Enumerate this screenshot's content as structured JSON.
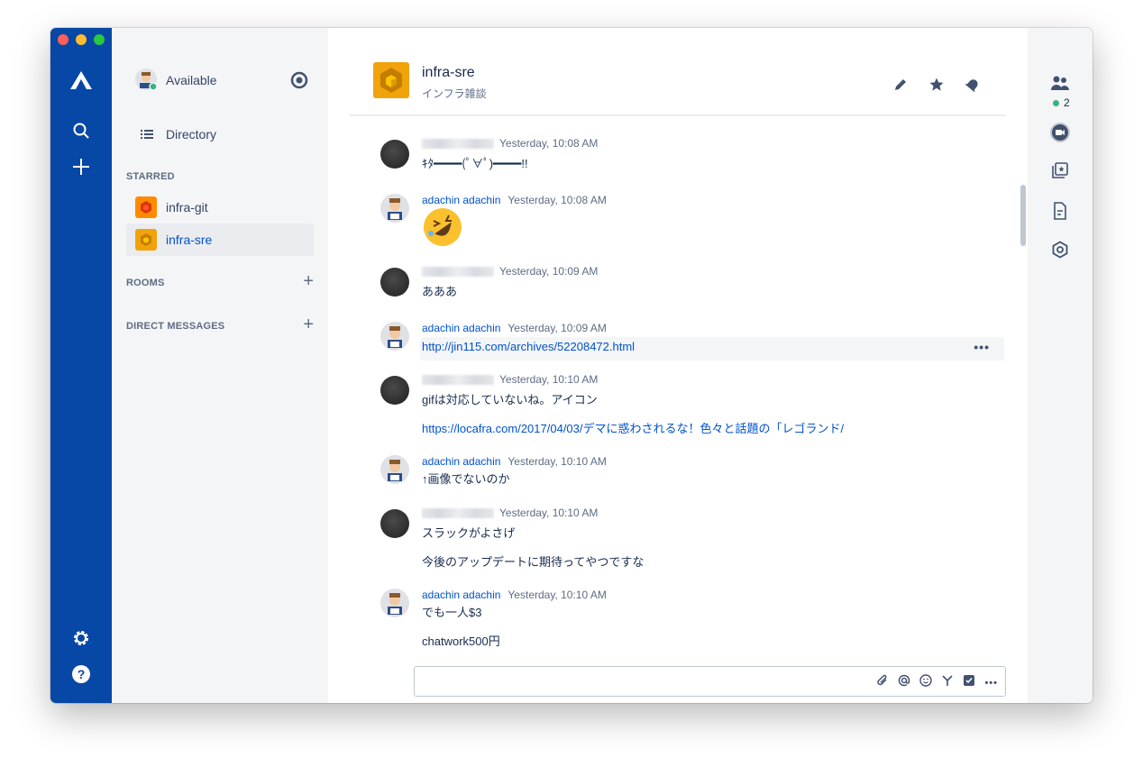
{
  "status": {
    "label": "Available"
  },
  "sidebar": {
    "directory_label": "Directory",
    "starred_heading": "STARRED",
    "rooms_heading": "ROOMS",
    "dm_heading": "DIRECT MESSAGES",
    "starred": [
      {
        "label": "infra-git",
        "active": false
      },
      {
        "label": "infra-sre",
        "active": true
      }
    ]
  },
  "header": {
    "title": "infra-sre",
    "topic": "インフラ雑談"
  },
  "rail": {
    "people_count": "2"
  },
  "messages": [
    {
      "author": "",
      "time": "Yesterday, 10:08 AM",
      "lines": [
        "ｷﾀ━━━━(ﾟ∀ﾟ)━━━━!!"
      ]
    },
    {
      "author": "adachin adachin",
      "time": "Yesterday, 10:08 AM",
      "lines": []
    },
    {
      "author": "",
      "time": "Yesterday, 10:09 AM",
      "lines": [
        "あああ"
      ]
    },
    {
      "author": "adachin adachin",
      "time": "Yesterday, 10:09 AM",
      "lines": [
        "http://jin115.com/archives/52208472.html"
      ]
    },
    {
      "author": "",
      "time": "Yesterday, 10:10 AM",
      "lines": [
        "gifは対応していないね。アイコン",
        "https://locafra.com/2017/04/03/デマに惑わされるな！色々と話題の「レゴランド/"
      ]
    },
    {
      "author": "adachin adachin",
      "time": "Yesterday, 10:10 AM",
      "lines": [
        "↑画像でないのか"
      ]
    },
    {
      "author": "",
      "time": "Yesterday, 10:10 AM",
      "lines": [
        "スラックがよさげ",
        "今後のアップデートに期待ってやつですな"
      ]
    },
    {
      "author": "adachin adachin",
      "time": "Yesterday, 10:10 AM",
      "lines": [
        "でも一人$3",
        "chatwork500円"
      ]
    }
  ],
  "colors": {
    "global_nav": "#0747a6",
    "link": "#0052cc",
    "room_icon": "#f0a30a",
    "room_icon_alt": "#de350b"
  }
}
